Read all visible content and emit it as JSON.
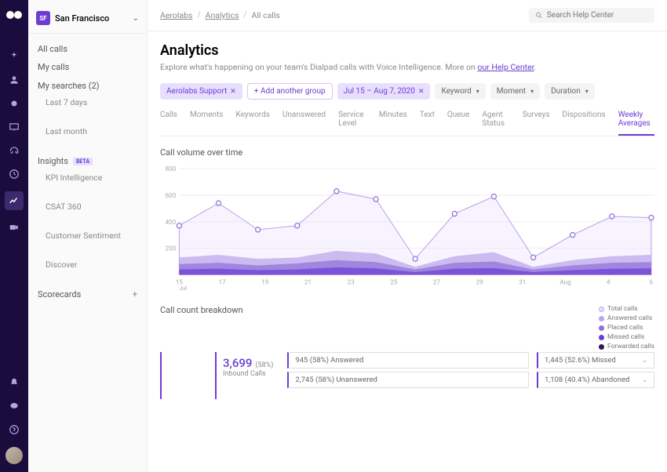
{
  "sidebar_header": {
    "initials": "SF",
    "name": "San Francisco"
  },
  "sidebar": {
    "allcalls": "All calls",
    "mycalls": "My calls",
    "mysearches": "My searches (2)",
    "last7": "Last 7 days",
    "lastmonth": "Last month",
    "insights": "Insights",
    "beta": "BETA",
    "kpi": "KPI Intelligence",
    "csat": "CSAT 360",
    "sentiment": "Customer Sentiment",
    "discover": "Discover",
    "scorecards": "Scorecards"
  },
  "breadcrumbs": [
    "Aerolabs",
    "Analytics",
    "All calls"
  ],
  "search": {
    "placeholder": "Search Help Center"
  },
  "title": "Analytics",
  "subtitle_pre": "Explore what's happening on your team's Dialpad calls with Voice Intelligence. More on ",
  "subtitle_link": "our Help Center",
  "filters": {
    "group": "Aerolabs Support",
    "add": "+ Add another group",
    "date": "Jul 15 – Aug 7, 2020",
    "keyword": "Keyword",
    "moment": "Moment",
    "duration": "Duration"
  },
  "tabs": [
    "Calls",
    "Moments",
    "Keywords",
    "Unanswered",
    "Service Level",
    "Minutes",
    "Text",
    "Queue",
    "Agent Status",
    "Surveys",
    "Dispositions",
    "Weekly Averages"
  ],
  "active_tab": "Weekly Averages",
  "chart_title": "Call volume over time",
  "chart_data": {
    "type": "area",
    "title": "Call volume over time",
    "xlabel": "",
    "ylabel": "",
    "ylim": [
      0,
      800
    ],
    "yticks": [
      200,
      400,
      600,
      800
    ],
    "categories": [
      "15",
      "17",
      "19",
      "21",
      "23",
      "25",
      "27",
      "29",
      "31",
      "Aug",
      "4",
      "6"
    ],
    "x_sublabel_first": "Jul",
    "series": [
      {
        "name": "Total calls",
        "color": "#e8dfff",
        "marker": "#6c3dd4",
        "values": [
          370,
          540,
          340,
          370,
          630,
          570,
          120,
          460,
          590,
          130,
          300,
          440,
          430
        ]
      },
      {
        "name": "Answered calls",
        "color": "#b9a3ea",
        "values": [
          130,
          150,
          120,
          130,
          180,
          160,
          60,
          140,
          170,
          60,
          110,
          140,
          150
        ]
      },
      {
        "name": "Placed calls",
        "color": "#8e6fd8",
        "values": [
          80,
          90,
          70,
          85,
          110,
          95,
          40,
          90,
          100,
          40,
          70,
          90,
          95
        ]
      },
      {
        "name": "Missed calls",
        "color": "#6c3dd4",
        "values": [
          40,
          45,
          35,
          40,
          55,
          48,
          20,
          45,
          50,
          20,
          35,
          45,
          48
        ]
      }
    ]
  },
  "breakdown_title": "Call count breakdown",
  "breakdown": {
    "inbound_value": "3,699",
    "inbound_pct": "(58%)",
    "inbound_label": "Inbound Calls",
    "answered": "945 (58%) Answered",
    "unanswered": "2,745 (58%) Unanswered",
    "missed": "1,445 (52.6%) Missed",
    "abandoned": "1,108 (40.4%) Abandoned"
  },
  "legend": {
    "total": "Total calls",
    "answered": "Answered calls",
    "placed": "Placed calls",
    "missed": "Missed calls",
    "forwarded": "Forwarded calls"
  },
  "legend_colors": {
    "total": "#e8dfff",
    "answered": "#b9a3ea",
    "placed": "#8e6fd8",
    "missed": "#6c3dd4",
    "forwarded": "#2d1b59"
  }
}
